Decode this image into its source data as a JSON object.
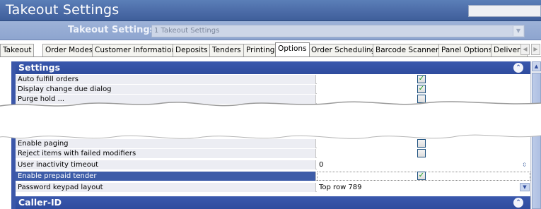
{
  "window": {
    "title": "Takeout Settings"
  },
  "settings_selector": {
    "label": "Takeout Settings:",
    "value": "1 Takeout Settings"
  },
  "tabs": [
    {
      "label": "Takeout"
    },
    {
      "label": "Order Modes"
    },
    {
      "label": "Customer Information"
    },
    {
      "label": "Deposits"
    },
    {
      "label": "Tenders"
    },
    {
      "label": "Printing"
    },
    {
      "label": "Options",
      "active": true
    },
    {
      "label": "Order Scheduling"
    },
    {
      "label": "Barcode Scanners"
    },
    {
      "label": "Panel Options"
    },
    {
      "label": "Delivery"
    }
  ],
  "sections": {
    "settings": {
      "title": "Settings"
    },
    "caller_id": {
      "title": "Caller-ID"
    }
  },
  "rows_top": [
    {
      "label": "Auto fulfill orders",
      "checked": true
    },
    {
      "label": "Display change due dialog",
      "checked": true
    },
    {
      "label": "Purge hold ... ",
      "checked": false
    }
  ],
  "rows_bottom": [
    {
      "label": "Enable paging",
      "checked": false
    },
    {
      "label": "Reject items with failed modifiers",
      "checked": false
    },
    {
      "label": "User inactivity timeout",
      "value": "0"
    },
    {
      "label": "Enable prepaid tender",
      "checked": true,
      "selected": true
    },
    {
      "label": "Password keypad layout",
      "value": "Top row 789"
    }
  ],
  "colors": {
    "title_bar": "#4a6aa6",
    "section_header": "#2f4c9e",
    "selected_row": "#3d5ca8"
  }
}
